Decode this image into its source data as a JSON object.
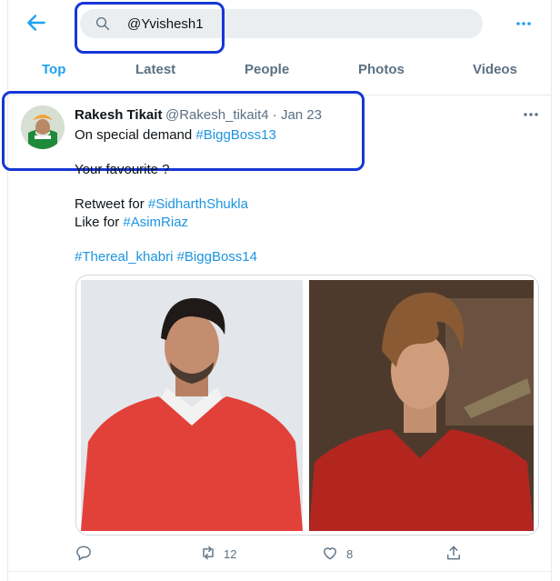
{
  "search": {
    "query": "@Yvishesh1"
  },
  "tabs": [
    {
      "label": "Top",
      "active": true
    },
    {
      "label": "Latest"
    },
    {
      "label": "People"
    },
    {
      "label": "Photos"
    },
    {
      "label": "Videos"
    }
  ],
  "tweet": {
    "author_name": "Rakesh Tikait",
    "author_handle_date": "@Rakesh_tikait4 · Jan 23",
    "line1_text": "On special demand ",
    "line1_tag": "#BiggBoss13",
    "line2": "Your favourite ?",
    "line3_text": "Retweet for ",
    "line3_tag": "#SidharthShukla",
    "line4_text": "Like for ",
    "line4_tag": "#AsimRiaz",
    "tags_a": "#Thereal_khabri",
    "tags_b": "#BiggBoss14",
    "retweets": "12",
    "likes": "8"
  },
  "colors": {
    "accent": "#1da1f2",
    "highlight_box": "#1537d6",
    "muted": "#5b7083"
  },
  "icons": [
    "back-arrow-icon",
    "search-icon",
    "more-icon",
    "reply-icon",
    "retweet-icon",
    "like-icon",
    "share-icon"
  ]
}
